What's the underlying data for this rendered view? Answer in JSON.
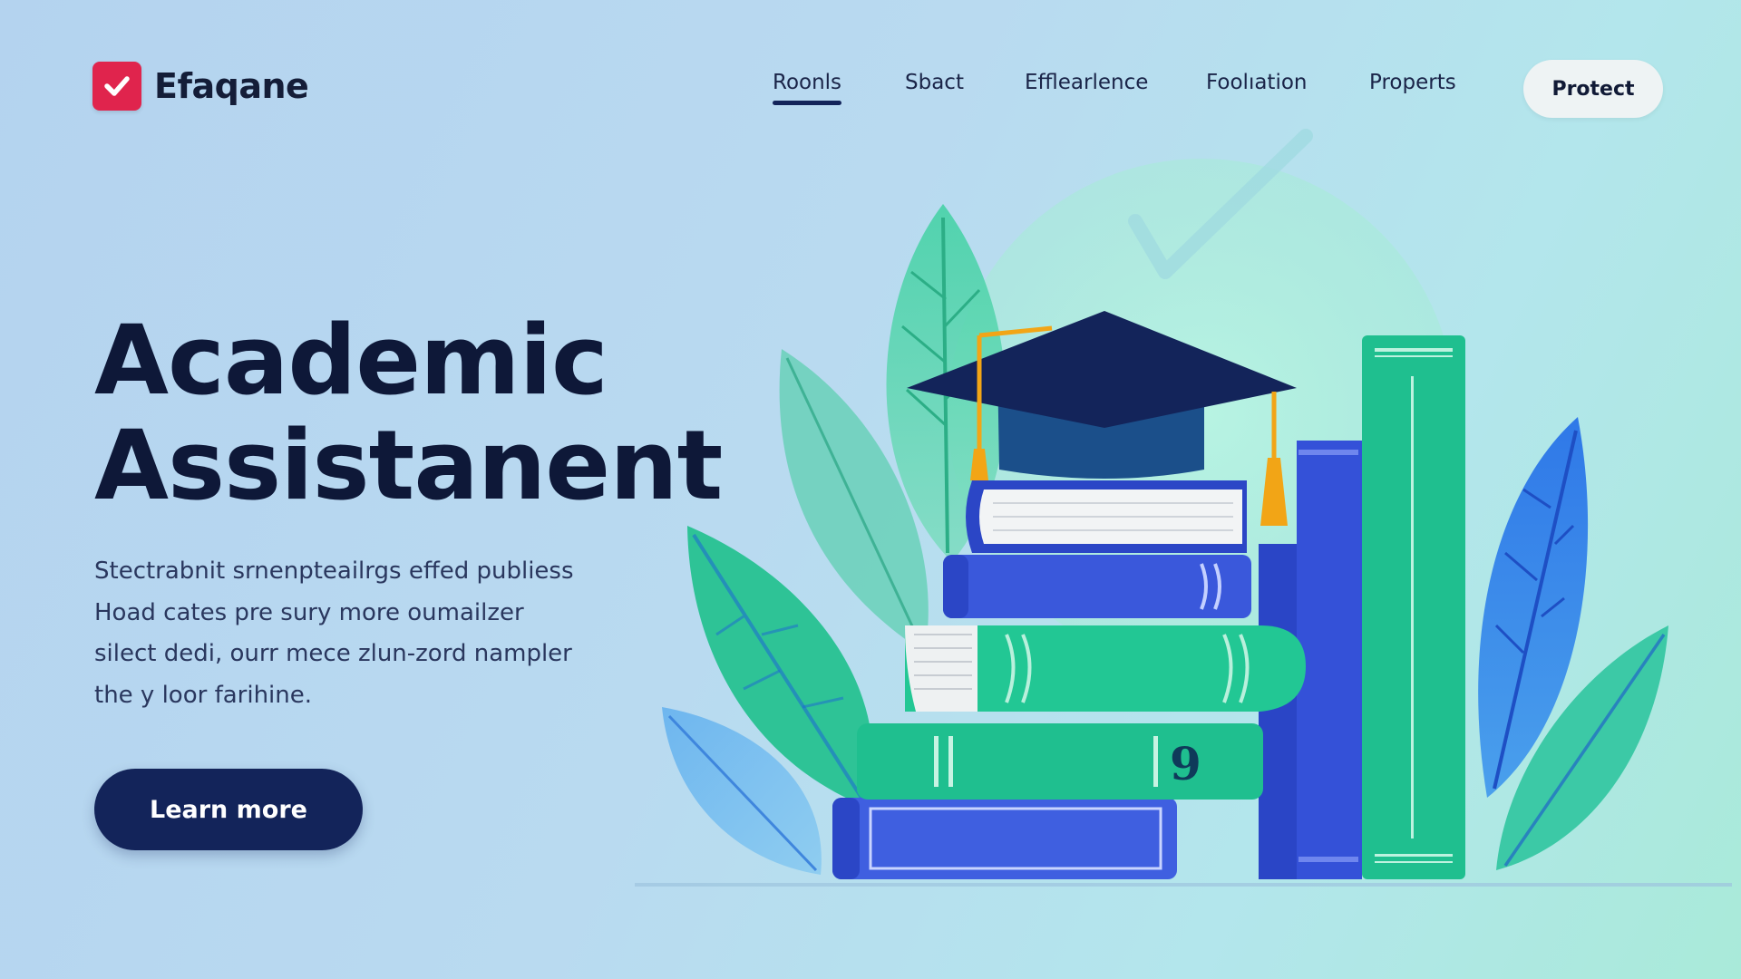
{
  "brand": {
    "name": "Efaqane",
    "logo_icon": "checkmark-icon",
    "logo_color": "#e0244d"
  },
  "nav": {
    "items": [
      {
        "label": "Roonls",
        "active": true
      },
      {
        "label": "Sbact",
        "active": false
      },
      {
        "label": "Efflearlence",
        "active": false
      },
      {
        "label": "Foolıation",
        "active": false
      },
      {
        "label": "Properts",
        "active": false
      }
    ],
    "cta_label": "Protect"
  },
  "hero": {
    "title_line1": "Academic",
    "title_line2": "Assistanent",
    "description_lines": [
      "Stectrabnit srnenpteailrgs effed publiess",
      "Hoad cates pre sury more oumailzer",
      "silect dedi, ourr mece zlun-zord nampler",
      "the y loor farihine."
    ],
    "button_label": "Learn more"
  },
  "colors": {
    "accent_dark": "#13245a",
    "green": "#1fbf8f",
    "blue": "#3f5fe0",
    "background": "#b9daf0"
  }
}
